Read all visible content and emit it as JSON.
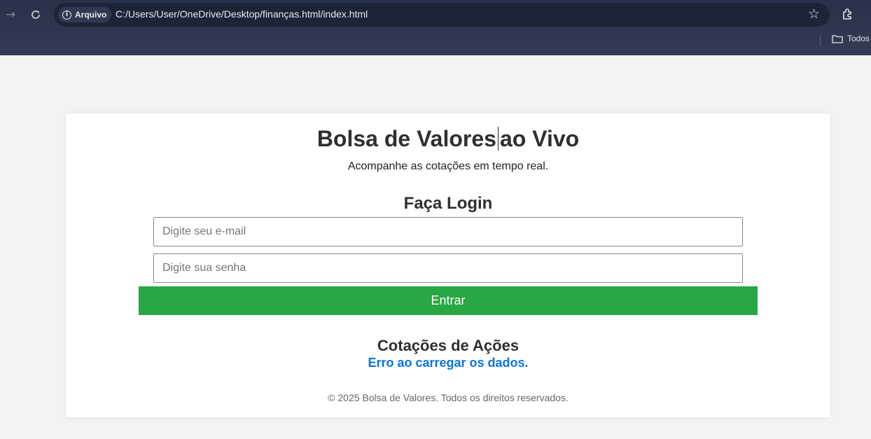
{
  "browser": {
    "security_label": "Arquivo",
    "url": "C:/Users/User/OneDrive/Desktop/finanças.html/index.html",
    "bookmark_folder": "Todos",
    "icons": [
      "forward-icon",
      "reload-icon",
      "info-icon",
      "star-icon",
      "extensions-icon",
      "folder-icon"
    ]
  },
  "header": {
    "title_part1": "Bolsa de Valores",
    "title_part2": "ao Vivo",
    "subtitle": "Acompanhe as cotações em tempo real."
  },
  "login": {
    "heading": "Faça Login",
    "email_placeholder": "Digite seu e-mail",
    "password_placeholder": "Digite sua senha",
    "submit_label": "Entrar"
  },
  "quotes": {
    "heading": "Cotações de Ações",
    "error_message": "Erro ao carregar os dados."
  },
  "footer": {
    "text": "© 2025 Bolsa de Valores. Todos os direitos reservados."
  },
  "colors": {
    "accent_green": "#28a745",
    "error_blue": "#0a74e0",
    "chrome_bg": "#27324a"
  }
}
